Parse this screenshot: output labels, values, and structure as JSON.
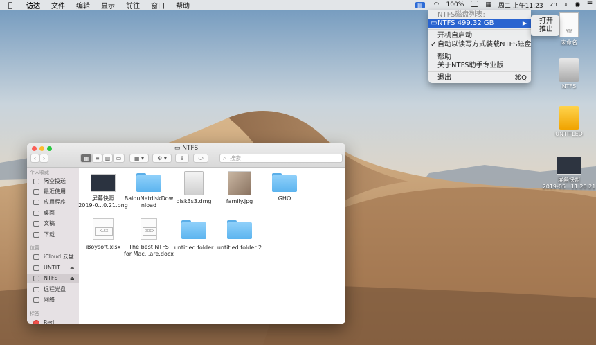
{
  "menubar": {
    "app_name": "访达",
    "items": [
      "文件",
      "编辑",
      "显示",
      "前往",
      "窗口",
      "帮助"
    ],
    "battery": "100%",
    "datetime": "周二 上午11:23",
    "input_method": "zh"
  },
  "ntfs_menu": {
    "header": "NTFS磁盘列表:",
    "disk_item": "NTFS  499.32 GB",
    "launch_at_login": "开机自启动",
    "auto_mount": "自动以读写方式装载NTFS磁盘",
    "help": "帮助",
    "about": "关于NTFS助手专业版",
    "quit": "退出",
    "quit_shortcut": "⌘Q",
    "submenu": [
      "打开",
      "推出"
    ]
  },
  "desktop_icons": [
    {
      "label": "未命名",
      "tag": "RTF"
    },
    {
      "label": "NTFS"
    },
    {
      "label": "UNTITLED"
    },
    {
      "label": "屏幕快照\n2019-05...11.20.21"
    }
  ],
  "finder": {
    "title": "NTFS",
    "search_placeholder": "搜索",
    "sidebar": {
      "favorites_header": "个人收藏",
      "favorites": [
        "隔空投送",
        "最近使用",
        "应用程序",
        "桌面",
        "文稿",
        "下载"
      ],
      "locations_header": "位置",
      "locations": [
        "iCloud 云盘",
        "UNTIT...",
        "NTFS",
        "远程光盘",
        "网络"
      ],
      "tags_header": "标签",
      "tags": [
        "Red"
      ]
    },
    "files": [
      {
        "name": "屏幕快照\n2019-0...0.21.png",
        "kind": "screenshot"
      },
      {
        "name": "BaiduNetdiskDow\nnload",
        "kind": "folder"
      },
      {
        "name": "disk3s3.dmg",
        "kind": "dmg"
      },
      {
        "name": "family.jpg",
        "kind": "photo"
      },
      {
        "name": "GHO",
        "kind": "folder"
      },
      {
        "name": "iBoysoft.xlsx",
        "kind": "xlsx",
        "tag": "XLSX"
      },
      {
        "name": "The best NTFS\nfor Mac...are.docx",
        "kind": "docx",
        "tag": "DOCX"
      },
      {
        "name": "untitled folder",
        "kind": "folder"
      },
      {
        "name": "untitled folder 2",
        "kind": "folder"
      }
    ]
  },
  "colors": {
    "menu_highlight": "#2a64d0",
    "folder_blue": "#5cb4ef",
    "close": "#fc5f57",
    "minimize": "#fdbc2e",
    "zoom": "#28c840"
  }
}
